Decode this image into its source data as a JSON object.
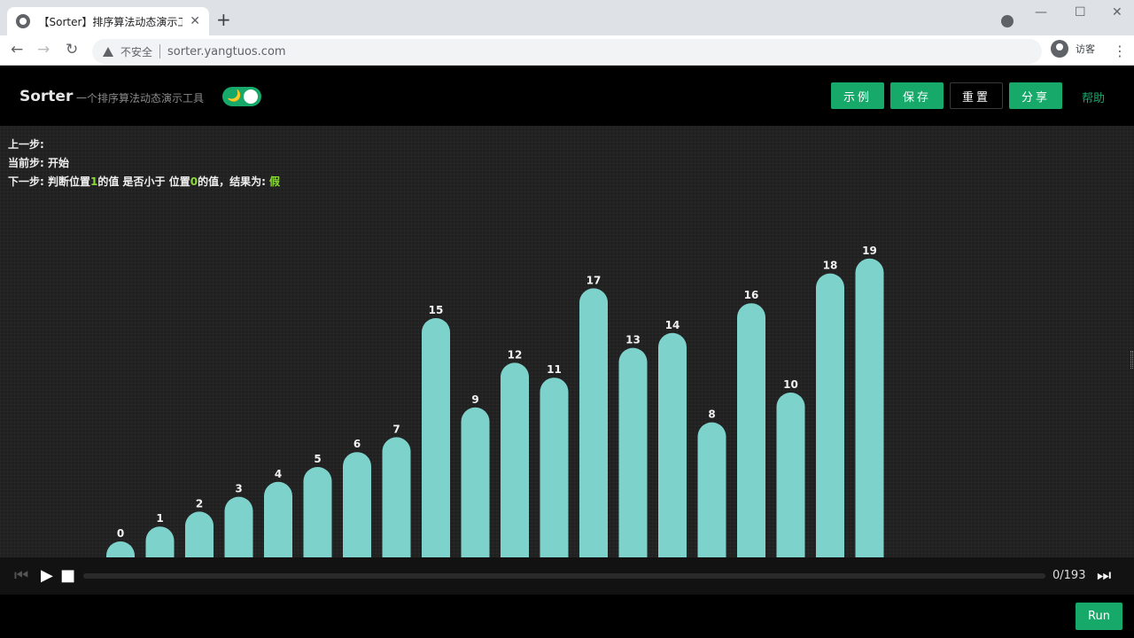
{
  "browser": {
    "tab_title": "【Sorter】排序算法动态演示工具",
    "tab_close": "✕",
    "new_tab": "+",
    "insecure_label": "不安全",
    "url": "sorter.yangtuos.com",
    "guest_label": "访客",
    "back": "←",
    "forward": "→",
    "reload": "↻",
    "menu": "⋮",
    "minimize": "—",
    "maximize": "☐",
    "close": "✕"
  },
  "app": {
    "brand": "Sorter",
    "subtitle": "一个排序算法动态演示工具",
    "toggle_icon": "🌙",
    "buttons": {
      "example": "示例",
      "save": "保存",
      "reset": "重置",
      "share": "分享",
      "help": "帮助"
    },
    "info": {
      "prev_label": "上一步:",
      "current_label": "当前步:",
      "current_value": "开始",
      "next_prefix": "下一步: 判断位置",
      "next_pos_a": "1",
      "next_mid": "的值 是否小于 位置",
      "next_pos_b": "0",
      "next_suffix": "的值，结果为: ",
      "next_result": "假"
    },
    "controls": {
      "first": "⏮",
      "play": "▶",
      "stop": "■",
      "last": "⏭",
      "progress": 0,
      "step_count": "0/193"
    },
    "run_label": "Run",
    "colors": {
      "accent": "#16a96a",
      "bar": "#7dd3cc",
      "highlight": "#8bd93a"
    }
  },
  "chart_data": {
    "type": "bar",
    "categories": [
      "0",
      "1",
      "2",
      "3",
      "4",
      "5",
      "6",
      "7",
      "8",
      "9",
      "10",
      "11",
      "12",
      "13",
      "14",
      "15",
      "16",
      "17",
      "18",
      "19"
    ],
    "values": [
      0,
      1,
      2,
      3,
      4,
      5,
      6,
      7,
      15,
      9,
      12,
      11,
      17,
      13,
      14,
      8,
      16,
      10,
      18,
      19
    ],
    "ylim": [
      0,
      19
    ]
  }
}
